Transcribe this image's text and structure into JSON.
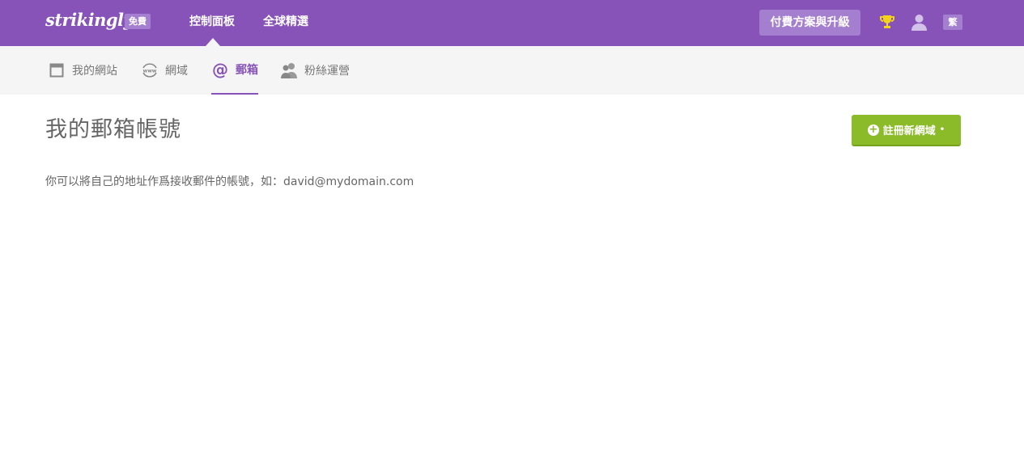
{
  "header": {
    "logo": "strikingly",
    "plan_badge": "免費",
    "nav": [
      {
        "label": "控制面板"
      },
      {
        "label": "全球精選"
      }
    ],
    "upgrade_label": "付費方案與升級",
    "lang_label": "繁"
  },
  "subnav": {
    "items": [
      {
        "label": "我的網站",
        "icon": "browser-window-icon"
      },
      {
        "label": "網域",
        "icon": "www-globe-icon"
      },
      {
        "label": "郵箱",
        "icon": "at-sign-icon",
        "active": true
      },
      {
        "label": "粉絲運營",
        "icon": "users-icon"
      }
    ]
  },
  "main": {
    "title": "我的郵箱帳號",
    "register_label": "註冊新網域",
    "description": "你可以將自己的地址作爲接收郵件的帳號，如：david@mydomain.com"
  },
  "colors": {
    "brand_purple": "#8753b8",
    "badge_purple": "#a57fcf",
    "action_green": "#8cbb2a",
    "trophy_yellow": "#f2d21b"
  }
}
